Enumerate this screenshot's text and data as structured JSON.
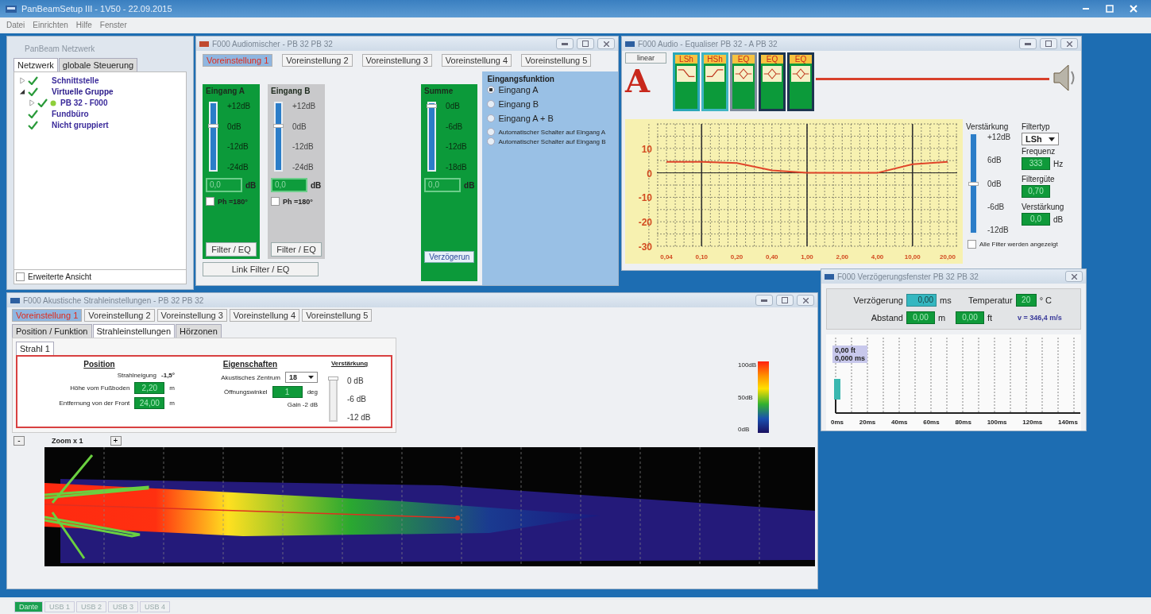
{
  "app": {
    "title": "PanBeamSetup III - 1V50 - 22.09.2015",
    "menu": [
      "Datei",
      "Einrichten",
      "Hilfe",
      "Fenster"
    ]
  },
  "network": {
    "title": "PanBeam Netzwerk",
    "tabs": [
      {
        "label": "Netzwerk",
        "selected": true
      },
      {
        "label": "globale Steuerung",
        "selected": false
      }
    ],
    "tree": [
      {
        "label": "Schnittstelle",
        "kind": "group",
        "expanded": false,
        "checked": true
      },
      {
        "label": "Virtuelle Gruppe",
        "kind": "group",
        "expanded": true,
        "checked": true,
        "children": [
          {
            "label": "PB 32 - F000",
            "kind": "group",
            "expanded": false,
            "checked": true,
            "online": true
          }
        ]
      },
      {
        "label": "Fundbüro",
        "kind": "leaf",
        "checked": true
      },
      {
        "label": "Nicht gruppiert",
        "kind": "leaf",
        "checked": true
      }
    ],
    "advanced": {
      "label": "Erweiterte Ansicht",
      "checked": false
    }
  },
  "mixer": {
    "title": "F000 Audiomischer - PB 32 PB 32",
    "presets": [
      {
        "label": "Voreinstellung 1",
        "selected": true
      },
      {
        "label": "Voreinstellung 2",
        "selected": false
      },
      {
        "label": "Voreinstellung 3",
        "selected": false
      },
      {
        "label": "Voreinstellung 4",
        "selected": false
      },
      {
        "label": "Voreinstellung 5",
        "selected": false
      }
    ],
    "channels": [
      {
        "name": "Eingang A",
        "active": true,
        "scale": [
          "+12dB",
          "0dB",
          "-12dB",
          "-24dB"
        ],
        "level": 0.67,
        "value": "0,0",
        "unit": "dB",
        "phase": {
          "label": "Ph =180°",
          "checked": false
        },
        "button": "Filter / EQ"
      },
      {
        "name": "Eingang B",
        "active": false,
        "scale": [
          "+12dB",
          "0dB",
          "-12dB",
          "-24dB"
        ],
        "level": 0.67,
        "value": "0,0",
        "unit": "dB",
        "phase": {
          "label": "Ph =180°",
          "checked": false
        },
        "button": "Filter / EQ"
      }
    ],
    "link_button": "Link Filter / EQ",
    "sum": {
      "name": "Summe",
      "scale": [
        "0dB",
        "-6dB",
        "-12dB",
        "-18dB"
      ],
      "level": 0.97,
      "value": "0,0",
      "unit": "dB",
      "button": "Verzögerun"
    },
    "input_function": {
      "title": "Eingangsfunktion",
      "options": [
        {
          "label": "Eingang A",
          "selected": true
        },
        {
          "label": "Eingang B",
          "selected": false
        },
        {
          "label": "Eingang A + B",
          "selected": false
        },
        {
          "label": "Automatischer Schalter auf Eingang A",
          "selected": false
        },
        {
          "label": "Automatischer Schalter auf Eingang B",
          "selected": false
        }
      ]
    }
  },
  "equalizer": {
    "title": "F000 Audio - Equaliser PB 32 - A PB 32",
    "mode_button": "linear",
    "input_label": "A",
    "filters": [
      {
        "label": "LSh",
        "kind": "low-shelf",
        "color": "#2aa7b8"
      },
      {
        "label": "HSh",
        "kind": "high-shelf",
        "color": "#3fb4c4"
      },
      {
        "label": "EQ",
        "kind": "peak",
        "color": "#7d8c9c"
      },
      {
        "label": "EQ",
        "kind": "peak",
        "color": "#1d3550"
      },
      {
        "label": "EQ",
        "kind": "peak",
        "color": "#1d3550"
      }
    ],
    "chart_data": {
      "type": "line",
      "categories": [
        "0,04",
        "0,10",
        "0,20",
        "0,40",
        "1,00",
        "2,00",
        "4,00",
        "10,00",
        "20,00"
      ],
      "series": [
        {
          "color": "#e0452a",
          "values": [
            4.5,
            4.5,
            4,
            1,
            0,
            0,
            0,
            3.5,
            4.5
          ]
        }
      ],
      "ylim": [
        -30,
        20
      ],
      "yticks": [
        -30,
        -20,
        -10,
        0,
        10
      ],
      "grid": true
    },
    "gain_slider": {
      "title": "Verstärkung",
      "scale": [
        "+12dB",
        "6dB",
        "0dB",
        "-6dB",
        "-12dB"
      ],
      "level": 0.5
    },
    "filter_type": {
      "label": "Filtertyp",
      "value": "LSh"
    },
    "frequency": {
      "label": "Frequenz",
      "value": "333",
      "unit": "Hz"
    },
    "quality": {
      "label": "Filtergüte",
      "value": "0,70"
    },
    "gain": {
      "label": "Verstärkung",
      "value": "0,0",
      "unit": "dB"
    },
    "show_all": {
      "label": "Alle Filter werden angezeigt",
      "checked": false
    }
  },
  "delay": {
    "title": "F000 Verzögerungsfenster PB 32 PB 32",
    "delay": {
      "label": "Verzögerung",
      "value": "0,00",
      "unit": "ms"
    },
    "temperature": {
      "label": "Temperatur",
      "value": "20",
      "unit": "° C"
    },
    "distance": {
      "label": "Abstand",
      "value": "0,00",
      "unit": "m"
    },
    "distance_ft": {
      "value": "0,00",
      "unit": "ft"
    },
    "speed": "v = 346,4 m/s",
    "plot": {
      "x_labels": [
        "0ms",
        "20ms",
        "40ms",
        "60ms",
        "80ms",
        "100ms",
        "120ms",
        "140ms"
      ],
      "marker_labels": [
        "0,00 ft",
        "0,000 ms"
      ]
    }
  },
  "beam": {
    "title": "F000 Akustische Strahleinstellungen - PB 32 PB 32",
    "presets": [
      {
        "label": "Voreinstellung 1",
        "selected": true
      },
      {
        "label": "Voreinstellung 2",
        "selected": false
      },
      {
        "label": "Voreinstellung 3",
        "selected": false
      },
      {
        "label": "Voreinstellung 4",
        "selected": false
      },
      {
        "label": "Voreinstellung 5",
        "selected": false
      }
    ],
    "sections": [
      {
        "label": "Position / Funktion",
        "selected": false
      },
      {
        "label": "Strahleinstellungen",
        "selected": true
      },
      {
        "label": "Hörzonen",
        "selected": false
      }
    ],
    "beams": [
      {
        "label": "Strahl 1",
        "selected": true
      }
    ],
    "position": {
      "title": "Position",
      "tilt": {
        "label": "Strahlneigung",
        "value": "-1,5°"
      },
      "height": {
        "label": "Höhe vom Fußboden",
        "value": "2,20",
        "unit": "m"
      },
      "distance": {
        "label": "Entfernung von der Front",
        "value": "24,00",
        "unit": "m"
      }
    },
    "properties": {
      "title": "Eigenschaften",
      "center": {
        "label": "Akustisches Zentrum",
        "value": "18"
      },
      "angle": {
        "label": "Öffnungswinkel",
        "value": "1",
        "unit": "deg"
      },
      "gain": "Gain -2 dB"
    },
    "gain": {
      "title": "Verstärkung",
      "scale": [
        "0 dB",
        "-6 dB",
        "-12 dB"
      ],
      "level": 1
    },
    "color_scale": [
      "100dB",
      "50dB",
      "0dB"
    ],
    "zoom": {
      "out": "-",
      "label": "Zoom x 1",
      "in": "+"
    }
  },
  "status_bar": {
    "tabs": [
      {
        "label": "Dante",
        "selected": true
      },
      {
        "label": "USB 1",
        "selected": false
      },
      {
        "label": "USB 2",
        "selected": false
      },
      {
        "label": "USB 3",
        "selected": false
      },
      {
        "label": "USB 4",
        "selected": false
      }
    ]
  }
}
